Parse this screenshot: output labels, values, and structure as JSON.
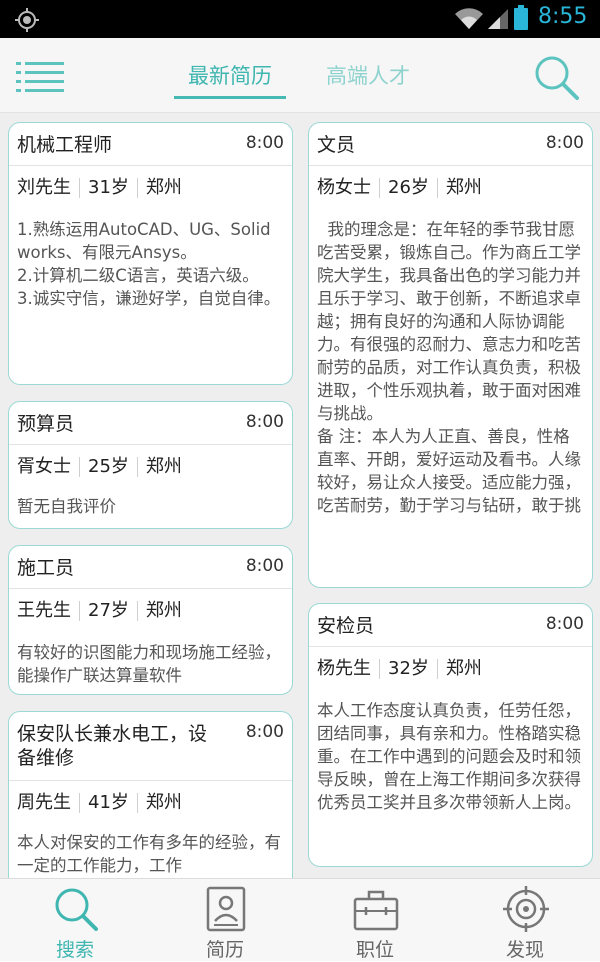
{
  "status_bar": {
    "time": "8:55",
    "icons": [
      "gps-icon",
      "wifi-icon",
      "signal-icon",
      "battery-icon"
    ]
  },
  "header": {
    "tabs": [
      {
        "label": "最新简历",
        "active": true
      },
      {
        "label": "高端人才",
        "active": false
      }
    ],
    "icons": [
      "menu-icon",
      "search-icon"
    ]
  },
  "resumes": [
    {
      "title": "机械工程师",
      "time": "8:00",
      "name": "刘先生",
      "age": "31岁",
      "city": "郑州",
      "desc": "1.熟练运用AutoCAD、UG、Solidworks、有限元Ansys。\n2.计算机二级C语言，英语六级。\n3.诚实守信，谦逊好学，自觉自律。"
    },
    {
      "title": "预算员",
      "time": "8:00",
      "name": "胥女士",
      "age": "25岁",
      "city": "郑州",
      "desc": "暂无自我评价"
    },
    {
      "title": "施工员",
      "time": "8:00",
      "name": "王先生",
      "age": "27岁",
      "city": "郑州",
      "desc": "有较好的识图能力和现场施工经验，能操作广联达算量软件"
    },
    {
      "title": "保安队长兼水电工，设备维修",
      "time": "8:00",
      "name": "周先生",
      "age": "41岁",
      "city": "郑州",
      "desc": "本人对保安的工作有多年的经验，有一定的工作能力，工作"
    },
    {
      "title": "文员",
      "time": "8:00",
      "name": "杨女士",
      "age": "26岁",
      "city": "郑州",
      "desc": "  我的理念是：在年轻的季节我甘愿吃苦受累，锻炼自己。作为商丘工学院大学生，我具备出色的学习能力并且乐于学习、敢于创新，不断追求卓越；拥有良好的沟通和人际协调能力。有很强的忍耐力、意志力和吃苦耐劳的品质，对工作认真负责，积极进取，个性乐观执着，敢于面对困难与挑战。\n备 注：本人为人正直、善良，性格直率、开朗，爱好运动及看书。人缘较好，易让众人接受。适应能力强，吃苦耐劳，勤于学习与钻研，敢于挑"
    },
    {
      "title": "安检员",
      "time": "8:00",
      "name": "杨先生",
      "age": "32岁",
      "city": "郑州",
      "desc": "本人工作态度认真负责，任劳任怨，团结同事，具有亲和力。性格踏实稳重。在工作中遇到的问题会及时和领导反映，曾在上海工作期间多次获得优秀员工奖并且多次带领新人上岗。"
    }
  ],
  "bottom_nav": [
    {
      "label": "搜索",
      "icon": "search-icon",
      "active": true
    },
    {
      "label": "简历",
      "icon": "resume-icon",
      "active": false
    },
    {
      "label": "职位",
      "icon": "briefcase-icon",
      "active": false
    },
    {
      "label": "发现",
      "icon": "target-icon",
      "active": false
    }
  ],
  "colors": {
    "accent": "#3fb6b0",
    "accent_light": "#8fd3cf",
    "card_border": "#9bd9d5",
    "status_time": "#29b6d8"
  }
}
